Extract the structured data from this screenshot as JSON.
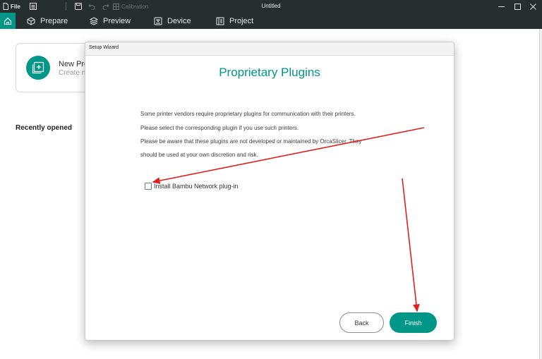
{
  "titlebar": {
    "file_label": "File",
    "calibration_label": "Calibration",
    "window_title": "Untitled"
  },
  "tabs": {
    "prepare": "Prepare",
    "preview": "Preview",
    "device": "Device",
    "project": "Project"
  },
  "home": {
    "new_project_title": "New Pro",
    "new_project_subtitle": "Create n",
    "recently_opened": "Recently opened"
  },
  "dialog": {
    "window_title": "Setup Wizard",
    "heading": "Proprietary Plugins",
    "lines": [
      "Some printer vendors require proprietary plugins for communication with their printers.",
      "Please select the corresponding plugin if you use such printers.",
      "Please be aware that these plugins are not developed or maintained by OrcaSlicer. They",
      "should be used at your own discretion and risk."
    ],
    "checkbox_label": "Install Bambu Network plug-in",
    "checkbox_checked": false,
    "back_label": "Back",
    "finish_label": "Finish"
  },
  "colors": {
    "accent": "#009688",
    "chrome": "#262e30",
    "annotation": "#e0201f"
  },
  "icons": [
    "file-icon",
    "menu-icon",
    "save-icon",
    "undo-icon",
    "redo-icon",
    "calibration-icon",
    "minimize-icon",
    "maximize-icon",
    "close-icon",
    "home-icon",
    "prepare-icon",
    "preview-icon",
    "device-icon",
    "project-icon",
    "new-project-icon"
  ]
}
